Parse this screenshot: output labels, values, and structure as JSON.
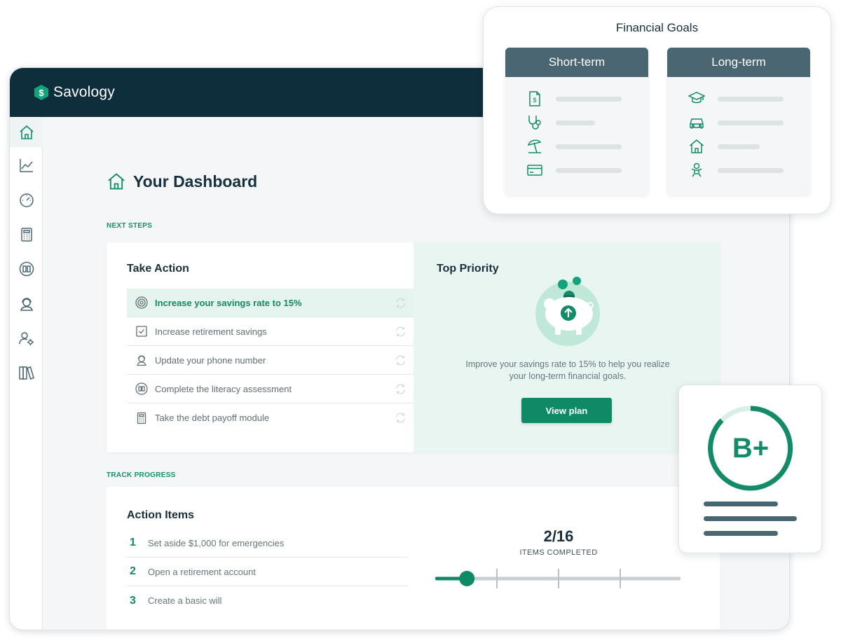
{
  "brand": {
    "name": "Savology"
  },
  "sidebar": {
    "items": [
      {
        "icon": "home-icon"
      },
      {
        "icon": "chart-line-icon"
      },
      {
        "icon": "gauge-icon"
      },
      {
        "icon": "calculator-icon"
      },
      {
        "icon": "book-icon"
      },
      {
        "icon": "user-headset-icon"
      },
      {
        "icon": "user-settings-icon"
      },
      {
        "icon": "library-icon"
      }
    ]
  },
  "dashboard": {
    "title": "Your Dashboard"
  },
  "next_steps": {
    "label": "NEXT STEPS",
    "take_action": {
      "title": "Take Action",
      "items": [
        {
          "label": "Increase your savings rate to 15%",
          "icon": "target-icon"
        },
        {
          "label": "Increase retirement savings",
          "icon": "checkbox-icon"
        },
        {
          "label": "Update your phone number",
          "icon": "user-headset-icon"
        },
        {
          "label": "Complete the literacy assessment",
          "icon": "book-icon"
        },
        {
          "label": "Take the debt payoff module",
          "icon": "calculator-icon"
        }
      ]
    },
    "top_priority": {
      "title": "Top Priority",
      "text_line1": "Improve your savings rate to 15% to help you realize",
      "text_line2": "your long-term financial goals.",
      "button": "View plan"
    }
  },
  "track_progress": {
    "label": "TRACK PROGRESS",
    "action_items": {
      "title": "Action Items",
      "items": [
        {
          "num": "1",
          "label": "Set aside $1,000 for emergencies"
        },
        {
          "num": "2",
          "label": "Open a retirement account"
        },
        {
          "num": "3",
          "label": "Create a basic will"
        }
      ]
    },
    "count": "2/16",
    "count_label": "ITEMS COMPLETED",
    "progress_fraction": 0.125
  },
  "goals": {
    "title": "Financial Goals",
    "short_term": {
      "title": "Short-term",
      "icons": [
        "invoice-icon",
        "stethoscope-icon",
        "beach-umbrella-icon",
        "credit-card-icon"
      ]
    },
    "long_term": {
      "title": "Long-term",
      "icons": [
        "graduation-cap-icon",
        "car-icon",
        "house-icon",
        "baby-icon"
      ]
    }
  },
  "grade": {
    "value": "B+"
  },
  "colors": {
    "brand_dark": "#0f2e3b",
    "accent_green": "#0f8a66",
    "slate": "#4a6672",
    "mint": "#e8f5f0"
  }
}
